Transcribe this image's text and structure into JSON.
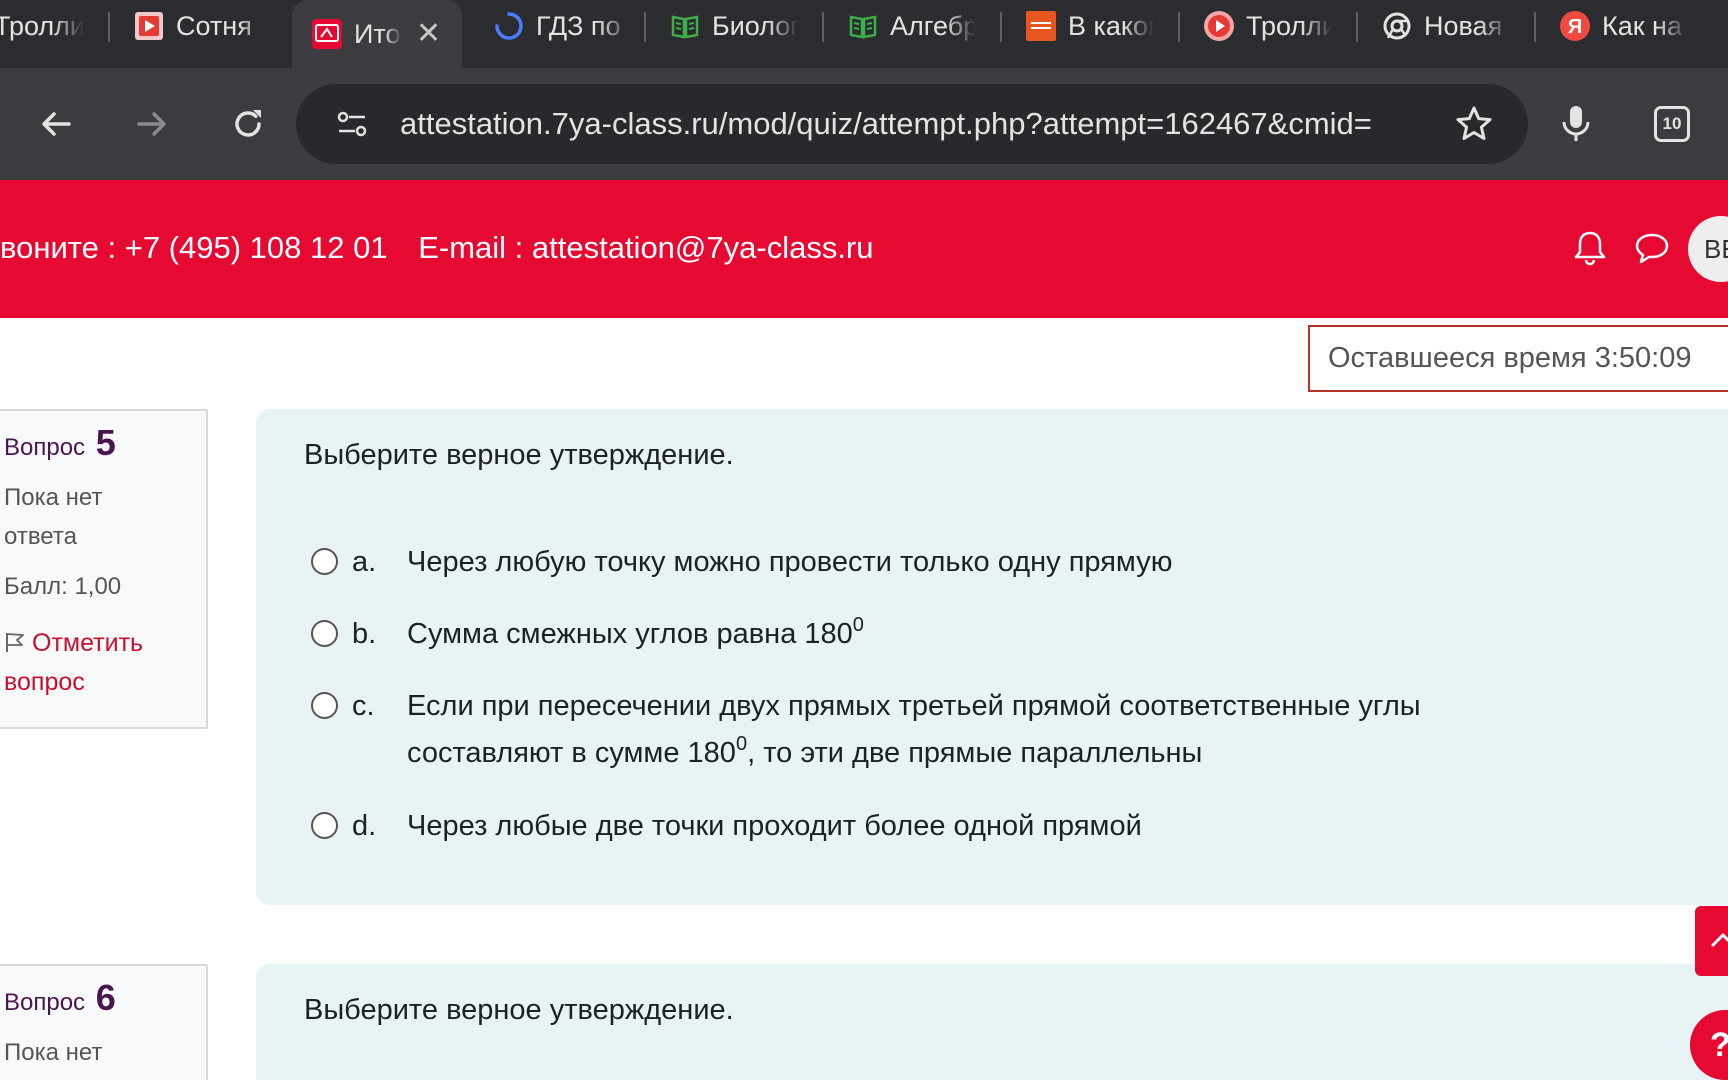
{
  "browser": {
    "tabs": [
      {
        "title": "Тролли",
        "favicon": "red-play-icon",
        "active": false
      },
      {
        "title": "Сотня",
        "favicon": "red-square-play-icon",
        "active": false
      },
      {
        "title": "Итоговая",
        "favicon": "7ya-class-icon",
        "active": true
      },
      {
        "title": "ГДЗ по",
        "favicon": "loading-spinner-icon",
        "active": false
      },
      {
        "title": "Биология",
        "favicon": "green-book-icon",
        "active": false
      },
      {
        "title": "Алгебра",
        "favicon": "green-book-icon",
        "active": false
      },
      {
        "title": "В каком",
        "favicon": "kino-afisha-icon",
        "active": false
      },
      {
        "title": "Тролли",
        "favicon": "red-play-icon",
        "active": false
      },
      {
        "title": "Новая",
        "favicon": "chrome-icon",
        "active": false
      },
      {
        "title": "Как на",
        "favicon": "yandex-icon",
        "active": false
      }
    ],
    "url": "attestation.7ya-class.ru/mod/quiz/attempt.php?attempt=162467&cmid=",
    "tab_count": "10"
  },
  "site": {
    "phone_text": "воните : +7 (495) 108 12 01",
    "email_text": "E-mail : attestation@7ya-class.ru",
    "avatar_initials": "ВЕ",
    "accent_color": "#e60a33"
  },
  "timer": {
    "label": "Оставшееся время",
    "value": "3:50:09"
  },
  "questions": [
    {
      "label": "Вопрос",
      "number": "5",
      "state": "Пока нет ответа",
      "grade": "Балл: 1,00",
      "flag_label": "Отметить вопрос",
      "text": "Выберите верное утверждение.",
      "answers": [
        {
          "letter": "a.",
          "text": "Через любую точку можно провести только одну прямую"
        },
        {
          "letter": "b.",
          "text": "Сумма смежных углов равна 180",
          "sup": "0"
        },
        {
          "letter": "c.",
          "text": "Если при пересечении двух прямых третьей прямой соответственные углы составляют в сумме 180",
          "sup": "0",
          "text_after": ", то эти две прямые параллельны"
        },
        {
          "letter": "d.",
          "text": "Через любые две точки проходит более одной прямой"
        }
      ]
    },
    {
      "label": "Вопрос",
      "number": "6",
      "state": "Пока нет ответа",
      "text": "Выберите верное утверждение."
    }
  ],
  "help_label": "?"
}
